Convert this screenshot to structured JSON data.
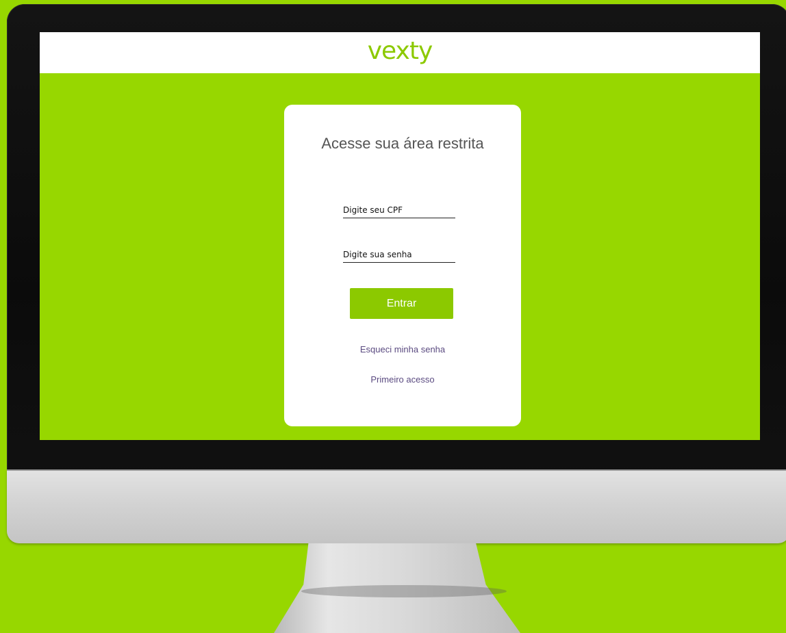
{
  "header": {
    "logo_text": "vexty"
  },
  "login": {
    "title": "Acesse sua área restrita",
    "cpf_placeholder": "Digite seu CPF",
    "password_placeholder": "Digite sua senha",
    "submit_label": "Entrar",
    "forgot_password_label": "Esqueci minha senha",
    "first_access_label": "Primeiro acesso"
  },
  "colors": {
    "brand_green": "#8cc900",
    "background_green": "#97d700",
    "link_purple": "#5a4a80",
    "title_gray": "#555555"
  }
}
